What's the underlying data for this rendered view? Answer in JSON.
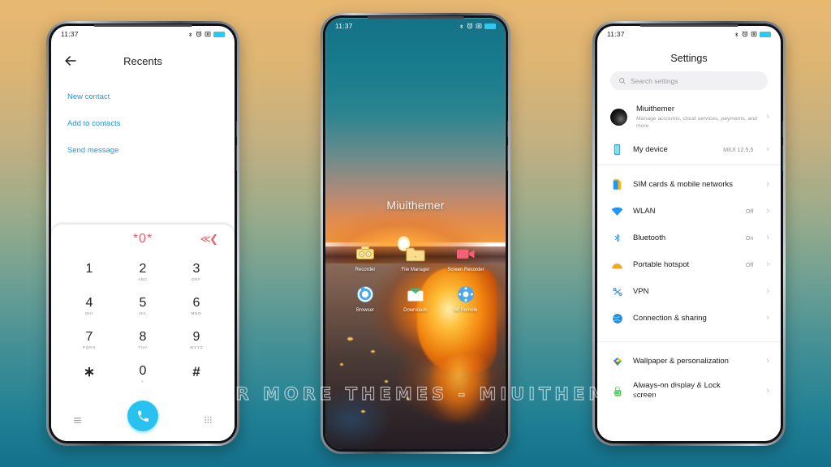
{
  "background": {
    "top_color": "#e8b871",
    "bottom_color": "#14718c"
  },
  "watermark": {
    "text": "VISIT FOR MORE THEMES - MIUITHEMER.COM"
  },
  "status_bar": {
    "time": "11:37",
    "icons": [
      "bluetooth-icon",
      "alarm-icon",
      "screenshot-icon",
      "battery-icon"
    ],
    "battery_color": "#2ec8ef"
  },
  "phone1_dialer": {
    "header": {
      "back_label": "back-arrow",
      "title": "Recents"
    },
    "links": [
      {
        "label": "New contact"
      },
      {
        "label": "Add to contacts"
      },
      {
        "label": "Send message"
      }
    ],
    "link_color": "#2196e8",
    "dialed_number": "*0*",
    "dialed_color": "#e4626f",
    "backspace_glyph": "≪<",
    "keys": [
      {
        "num": "1",
        "sub": ""
      },
      {
        "num": "2",
        "sub": "ABC"
      },
      {
        "num": "3",
        "sub": "DEF"
      },
      {
        "num": "4",
        "sub": "GHI"
      },
      {
        "num": "5",
        "sub": "JKL"
      },
      {
        "num": "6",
        "sub": "MNO"
      },
      {
        "num": "7",
        "sub": "PQRS"
      },
      {
        "num": "8",
        "sub": "TUV"
      },
      {
        "num": "9",
        "sub": "WXYZ"
      },
      {
        "num": "∗",
        "sub": ","
      },
      {
        "num": "0",
        "sub": "+"
      },
      {
        "num": "#",
        "sub": ""
      }
    ],
    "footer": {
      "menu_icon": "hamburger-menu-icon",
      "call_icon": "phone-call-icon",
      "keypad_icon": "keypad-grid-icon",
      "call_button_color": "#29c2f0"
    }
  },
  "phone2_home": {
    "wallpaper_name": "sunset-beach-glowing-jar",
    "label": "Miuithemer",
    "apps": [
      {
        "name": "Recorder",
        "icon": "recorder-icon"
      },
      {
        "name": "File Manager",
        "icon": "folder-icon"
      },
      {
        "name": "Screen Recorder",
        "icon": "video-camera-icon"
      },
      {
        "name": "Browser",
        "icon": "browser-icon"
      },
      {
        "name": "Downloads",
        "icon": "download-tray-icon"
      },
      {
        "name": "Mi Remote",
        "icon": "remote-control-icon"
      }
    ]
  },
  "phone3_settings": {
    "title": "Settings",
    "search": {
      "placeholder": "Search settings",
      "icon": "search-icon"
    },
    "account": {
      "name": "Miuithemer",
      "subtitle": "Manage accounts, cloud services, payments, and more",
      "avatar": "user-avatar"
    },
    "rows_group1": [
      {
        "label": "My device",
        "value": "MIUI 12.5.5",
        "icon": "phone-device-icon"
      }
    ],
    "rows_group2": [
      {
        "label": "SIM cards & mobile networks",
        "value": "",
        "icon": "sim-card-icon"
      },
      {
        "label": "WLAN",
        "value": "Off",
        "icon": "wifi-icon"
      },
      {
        "label": "Bluetooth",
        "value": "On",
        "icon": "bluetooth-icon"
      },
      {
        "label": "Portable hotspot",
        "value": "Off",
        "icon": "hotspot-icon"
      },
      {
        "label": "VPN",
        "value": "",
        "icon": "vpn-icon"
      },
      {
        "label": "Connection & sharing",
        "value": "",
        "icon": "globe-icon"
      }
    ],
    "rows_group3": [
      {
        "label": "Wallpaper & personalization",
        "value": "",
        "icon": "wallpaper-icon"
      },
      {
        "label": "Always-on display & Lock screen",
        "value": "",
        "icon": "lock-icon"
      }
    ],
    "chevron": "›"
  }
}
